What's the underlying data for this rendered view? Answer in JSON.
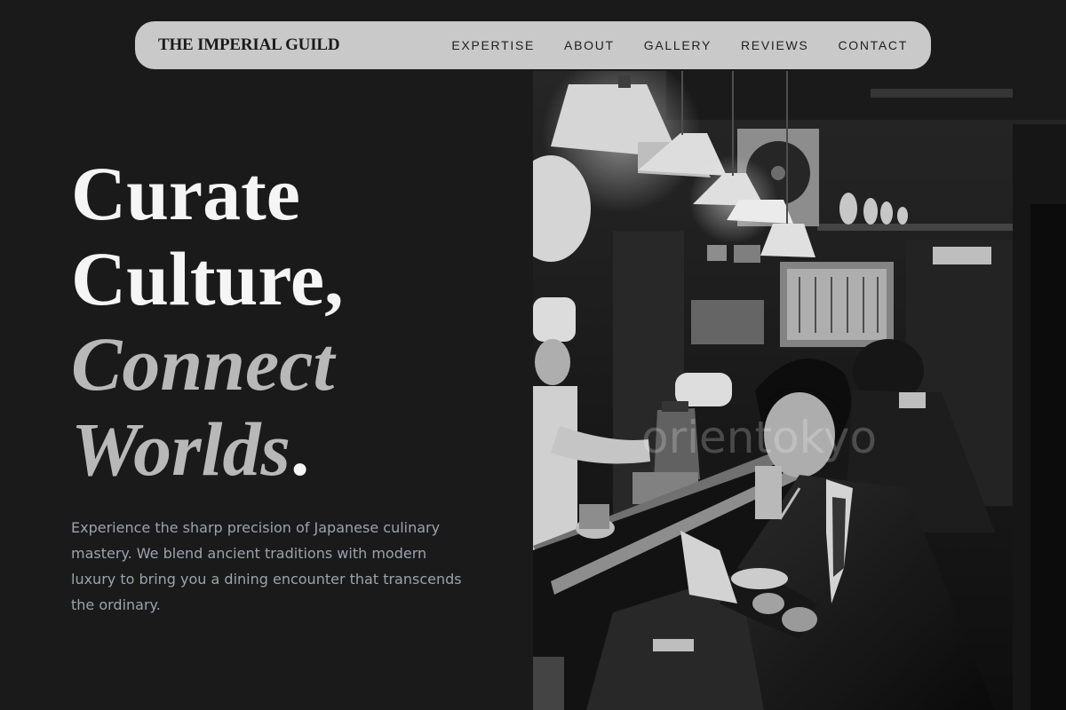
{
  "nav": {
    "brand": "THE IMPERIAL GUILD",
    "links": [
      "EXPERTISE",
      "ABOUT",
      "GALLERY",
      "REVIEWS",
      "CONTACT"
    ]
  },
  "hero": {
    "title_line1": "Curate",
    "title_line2": "Culture,",
    "title_line3": "Connect",
    "title_line4": "Worlds",
    "title_period": ".",
    "description": "Experience the sharp precision of Japanese culinary mastery. We blend ancient traditions with modern luxury to bring you a dining encounter that transcends the ordinary."
  },
  "photo": {
    "subject": "black-and-white photo of diners eating ramen at a Japanese counter bar",
    "watermark": "orientokyo"
  },
  "colors": {
    "background": "#1a1a1b",
    "nav_bg": "#c9c9c9",
    "title_white": "#f5f5f5",
    "title_grey": "#b8b8b8",
    "body_text": "#9fa2a8"
  }
}
